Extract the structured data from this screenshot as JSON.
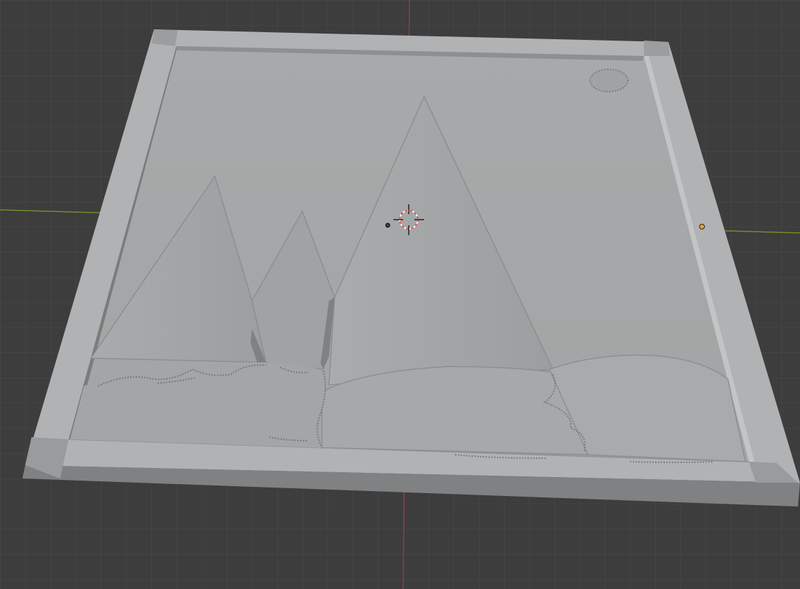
{
  "app": {
    "name": "3D Viewport",
    "colors": {
      "background": "#3d3d3d",
      "grid_line": "#4a4a4a",
      "x_axis": "#8a3f46",
      "y_axis": "#6f8f2c",
      "model_surface": "#a4a6a7",
      "frame_top": "#b2b4b5",
      "frame_side": "#8f9192",
      "relief_shadow": "#6d6f70",
      "origin_point": "#f2a23a",
      "cursor_red": "#e84d4d"
    }
  },
  "scene": {
    "object": "relief-panel",
    "features": [
      "mountain",
      "mountain",
      "mountain",
      "hill",
      "hill",
      "sun"
    ],
    "icons": {
      "cursor": "3d-cursor-icon",
      "origin": "object-origin-icon",
      "light": "light-icon"
    }
  }
}
